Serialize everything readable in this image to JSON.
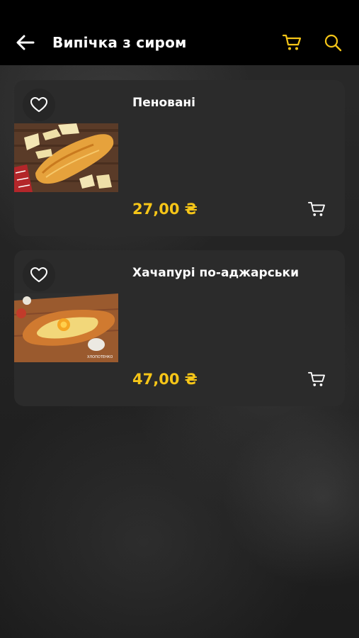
{
  "header": {
    "title": "Випічка з сиром",
    "back_icon": "arrow-left-icon",
    "cart_icon": "cart-icon",
    "search_icon": "search-icon",
    "accent_color": "#F5C518"
  },
  "products": [
    {
      "name": "Пеновані",
      "price": "27,00 ₴",
      "favorite_icon": "heart-outline-icon",
      "cart_icon": "cart-icon"
    },
    {
      "name": "Хачапурі по-аджарськи",
      "price": "47,00 ₴",
      "favorite_icon": "heart-outline-icon",
      "cart_icon": "cart-icon"
    }
  ],
  "colors": {
    "background": "#1f1f1f",
    "card": "#2b2b2b",
    "price": "#F5C518",
    "app_bar": "#000000"
  }
}
